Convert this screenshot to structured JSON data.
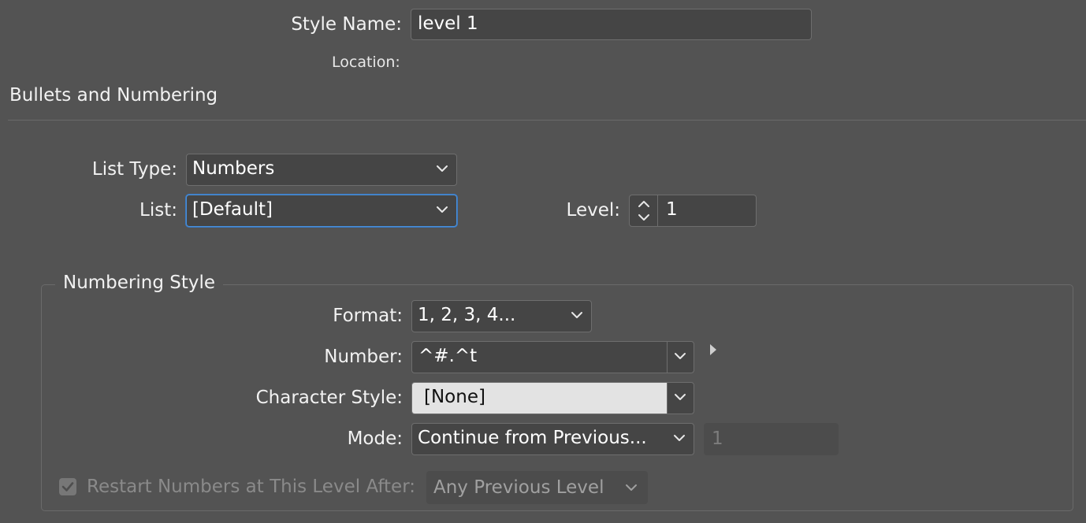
{
  "style_name": {
    "label": "Style Name:",
    "value": "level 1"
  },
  "location": {
    "label": "Location:",
    "value": ""
  },
  "section": {
    "title": "Bullets and Numbering"
  },
  "list_type": {
    "label": "List Type:",
    "value": "Numbers"
  },
  "list": {
    "label": "List:",
    "value": "[Default]"
  },
  "level": {
    "label": "Level:",
    "value": "1"
  },
  "numbering_style": {
    "title": "Numbering Style",
    "format": {
      "label": "Format:",
      "value": "1, 2, 3, 4..."
    },
    "number": {
      "label": "Number:",
      "value": "^#.^t"
    },
    "character_style": {
      "label": "Character Style:",
      "value": "[None]"
    },
    "mode": {
      "label": "Mode:",
      "value": "Continue from Previous...",
      "start_at": "1"
    },
    "restart": {
      "label": "Restart Numbers at This Level After:",
      "checked": true,
      "value": "Any Previous Level"
    }
  },
  "colors": {
    "background": "#535353",
    "field": "#454545",
    "focus_border": "#4a90d9"
  }
}
